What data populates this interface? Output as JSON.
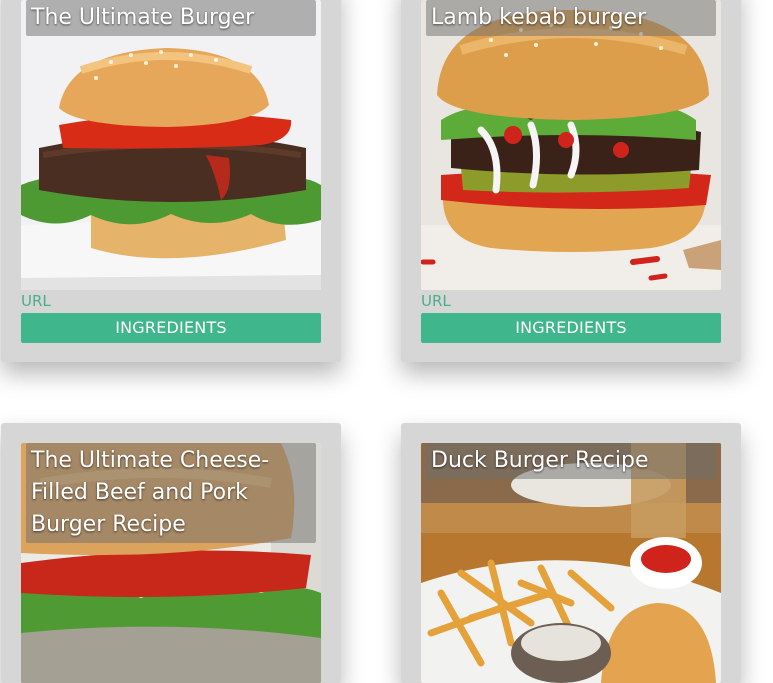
{
  "cards": [
    {
      "title": "The Ultimate Burger",
      "url_label": "URL",
      "button_label": "INGREDIENTS"
    },
    {
      "title": "Lamb kebab burger",
      "url_label": "URL",
      "button_label": "INGREDIENTS"
    },
    {
      "title": "The Ultimate Cheese-Filled Beef and Pork Burger Recipe"
    },
    {
      "title": "Duck Burger Recipe"
    }
  ],
  "colors": {
    "accent": "#3fb68b",
    "card_bg": "#d6d6d6",
    "url_text": "#47b08a"
  }
}
